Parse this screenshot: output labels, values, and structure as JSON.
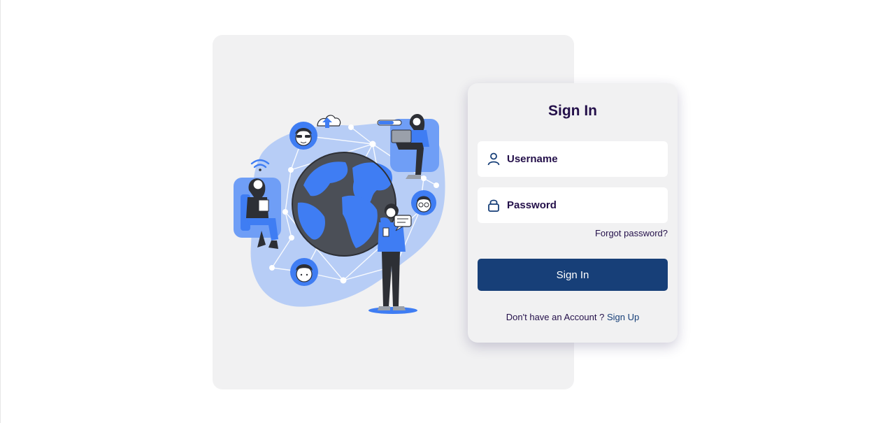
{
  "illustration": {
    "alt_icons": [
      "globe-icon",
      "cloud-upload-icon",
      "wifi-icon",
      "laptop-icon",
      "chat-bubble-icon"
    ]
  },
  "login": {
    "title": "Sign In",
    "username_placeholder": "Username",
    "password_placeholder": "Password",
    "forgot_password": "Forgot password?",
    "submit_label": "Sign In",
    "signup_prompt": "Don't have an Account ? ",
    "signup_link": "Sign Up"
  },
  "colors": {
    "accent": "#173f78",
    "title_text": "#24104a",
    "illustration_blue": "#3f7df3",
    "illustration_blob": "#b7cdf6"
  }
}
